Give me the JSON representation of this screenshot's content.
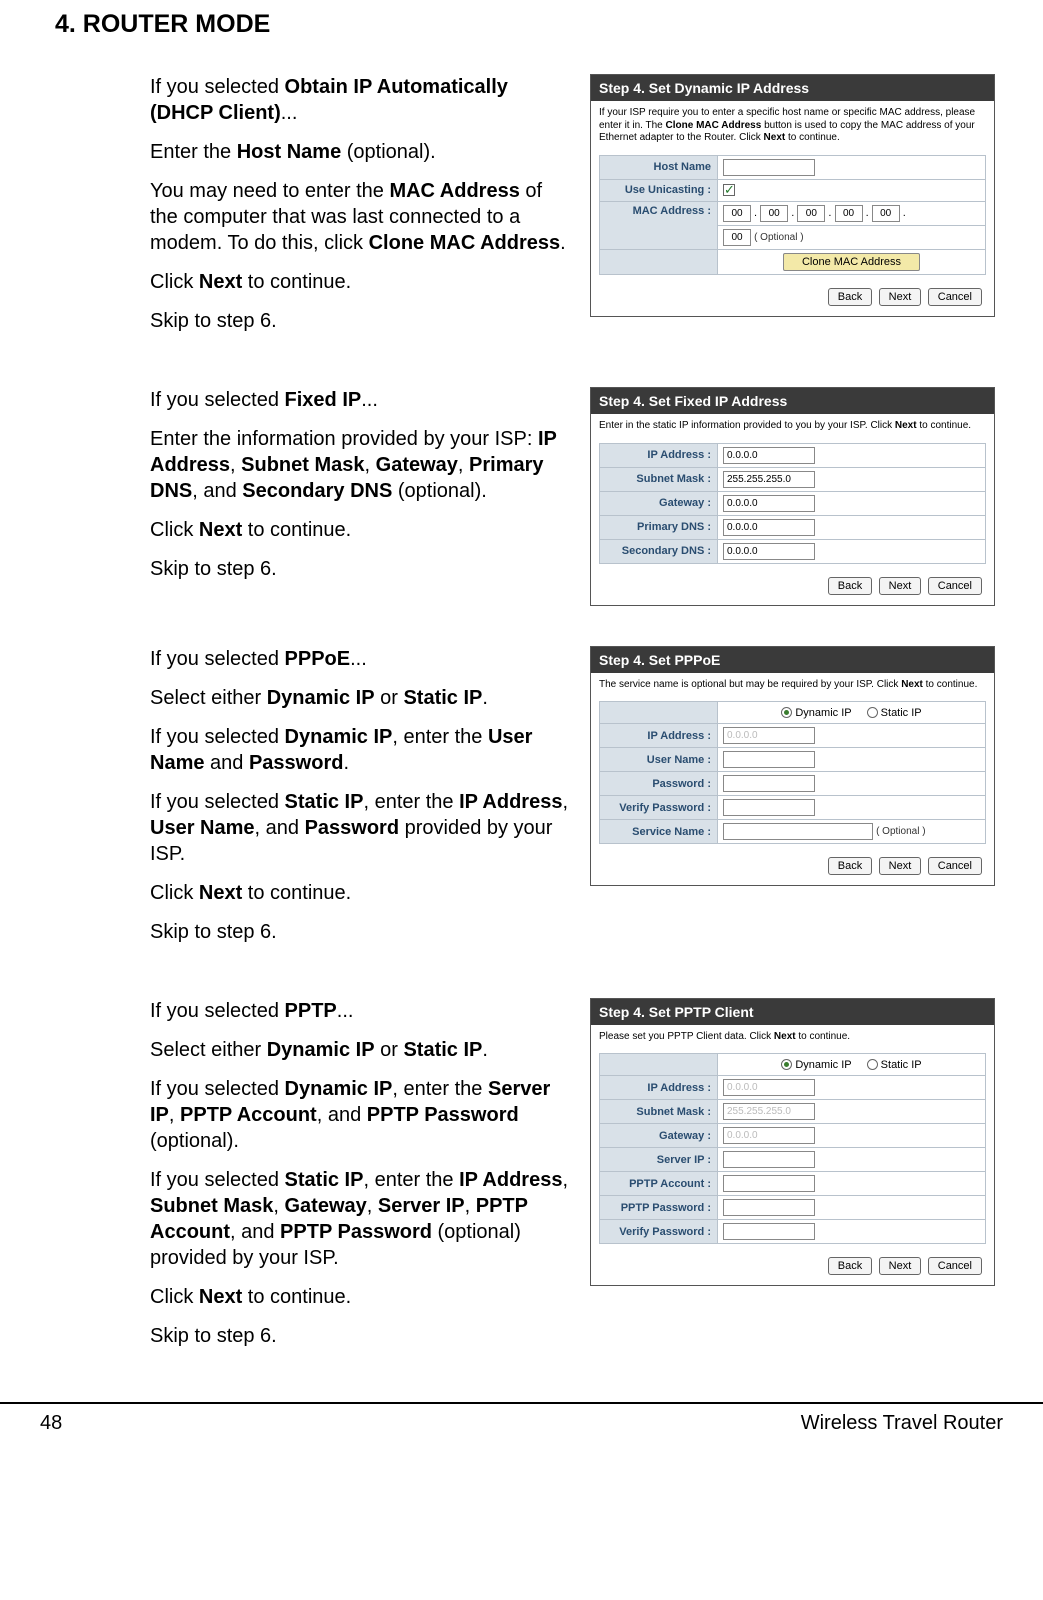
{
  "page": {
    "heading": "4.  ROUTER MODE",
    "number": "48",
    "footer_right": "Wireless Travel Router"
  },
  "buttons": {
    "back": "Back",
    "next": "Next",
    "cancel": "Cancel"
  },
  "sec_dhcp": {
    "p1a": "If you selected ",
    "p1b": "Obtain IP Automatically (DHCP Client)",
    "p1c": "...",
    "p2a": "Enter the ",
    "p2b": "Host Name",
    "p2c": " (optional).",
    "p3a": "You may need to enter the ",
    "p3b": "MAC Address",
    "p3c": " of the computer that was last connected to a modem. To do this, click ",
    "p3d": "Clone MAC Address",
    "p3e": ".",
    "p4a": "Click ",
    "p4b": "Next",
    "p4c": " to continue.",
    "p5": "Skip to step 6.",
    "panel_title": "Step 4. Set Dynamic IP Address",
    "instr_a": "If your ISP require you to enter a specific host name or specific MAC address, please enter it in. The ",
    "instr_b": "Clone MAC Address",
    "instr_c": " button is used to copy the MAC address of your Ethernet adapter to the Router. Click ",
    "instr_d": "Next",
    "instr_e": " to continue.",
    "row_host": "Host Name",
    "row_unicast": "Use Unicasting :",
    "row_mac": "MAC Address :",
    "mac_oct": "00",
    "mac_opt": "( Optional )",
    "clone_btn": "Clone MAC Address"
  },
  "sec_fixed": {
    "p1a": "If you selected ",
    "p1b": "Fixed IP",
    "p1c": "...",
    "p2a": "Enter the information provided by your ISP: ",
    "p2b": "IP Address",
    "p2c": ", ",
    "p2d": "Subnet Mask",
    "p2e": ", ",
    "p2f": "Gateway",
    "p2g": ", ",
    "p2h": "Primary DNS",
    "p2i": ", and ",
    "p2j": "Secondary DNS",
    "p2k": " (optional).",
    "p3a": "Click ",
    "p3b": "Next",
    "p3c": " to continue.",
    "p4": "Skip to step 6.",
    "panel_title": "Step 4. Set Fixed IP Address",
    "instr_a": "Enter in the static IP information provided to you by your ISP. Click ",
    "instr_b": "Next",
    "instr_c": " to continue.",
    "row_ip": "IP Address :",
    "val_ip": "0.0.0.0",
    "row_mask": "Subnet Mask :",
    "val_mask": "255.255.255.0",
    "row_gw": "Gateway :",
    "val_gw": "0.0.0.0",
    "row_pdns": "Primary DNS :",
    "val_pdns": "0.0.0.0",
    "row_sdns": "Secondary DNS :",
    "val_sdns": "0.0.0.0"
  },
  "sec_pppoe": {
    "p1a": "If you selected ",
    "p1b": "PPPoE",
    "p1c": "...",
    "p2a": "Select either  ",
    "p2b": "Dynamic IP",
    "p2c": " or ",
    "p2d": "Static IP",
    "p2e": ".",
    "p3a": "If you selected ",
    "p3b": "Dynamic IP",
    "p3c": ", enter the ",
    "p3d": "User Name",
    "p3e": " and ",
    "p3f": "Password",
    "p3g": ".",
    "p4a": "If you selected ",
    "p4b": "Static IP",
    "p4c": ", enter the ",
    "p4d": "IP Address",
    "p4e": ", ",
    "p4f": "User Name",
    "p4g": ", and ",
    "p4h": "Password",
    "p4i": " provided by your ISP.",
    "p5a": "Click ",
    "p5b": "Next",
    "p5c": " to continue.",
    "p6": "Skip to step 6.",
    "panel_title": "Step 4. Set PPPoE",
    "instr_a": "The service name is optional but may be required by your ISP. Click ",
    "instr_b": "Next",
    "instr_c": " to continue.",
    "radio_dyn": "Dynamic IP",
    "radio_stat": "Static IP",
    "row_ip": "IP Address :",
    "val_ip": "0.0.0.0",
    "row_user": "User Name :",
    "row_pass": "Password :",
    "row_vpass": "Verify Password :",
    "row_svc": "Service Name :",
    "svc_opt": "( Optional )"
  },
  "sec_pptp": {
    "p1a": "If you selected ",
    "p1b": "PPTP",
    "p1c": "...",
    "p2a": "Select either  ",
    "p2b": "Dynamic IP",
    "p2c": " or ",
    "p2d": "Static IP",
    "p2e": ".",
    "p3a": "If you selected ",
    "p3b": "Dynamic IP",
    "p3c": ", enter the ",
    "p3d": "Server IP",
    "p3e": ", ",
    "p3f": "PPTP Account",
    "p3g": ", and ",
    "p3h": "PPTP Password",
    "p3i": " (optional).",
    "p4a": "If you selected ",
    "p4b": "Static IP",
    "p4c": ", enter the ",
    "p4d": "IP Address",
    "p4e": ", ",
    "p4f": "Subnet Mask",
    "p4g": ", ",
    "p4h": "Gateway",
    "p4i": ", ",
    "p4j": "Server IP",
    "p4k": ", ",
    "p4l": "PPTP Account",
    "p4m": ", and ",
    "p4n": "PPTP Password",
    "p4o": " (optional) provided by your ISP.",
    "p5a": "Click ",
    "p5b": "Next",
    "p5c": " to continue.",
    "p6": "Skip to step 6.",
    "panel_title": "Step 4. Set PPTP Client",
    "instr_a": "Please set you PPTP Client data. Click ",
    "instr_b": "Next",
    "instr_c": " to continue.",
    "radio_dyn": "Dynamic IP",
    "radio_stat": "Static IP",
    "row_ip": "IP Address :",
    "val_ip": "0.0.0.0",
    "row_mask": "Subnet Mask :",
    "val_mask": "255.255.255.0",
    "row_gw": "Gateway :",
    "val_gw": "0.0.0.0",
    "row_sip": "Server IP :",
    "row_acct": "PPTP Account :",
    "row_pass": "PPTP Password :",
    "row_vpass": "Verify Password :"
  }
}
